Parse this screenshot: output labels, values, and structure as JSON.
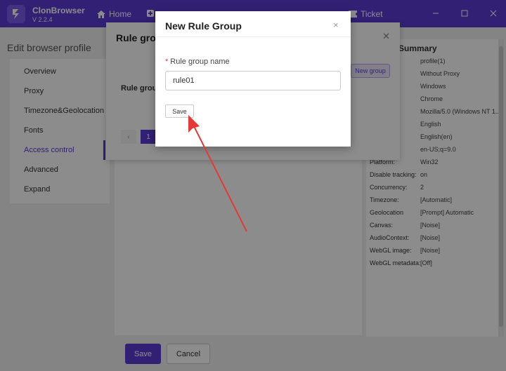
{
  "titlebar": {
    "app_name": "ClonBrowser",
    "version": "V 2.2.4",
    "home_label": "Home",
    "ticket_label": "Ticket"
  },
  "page": {
    "title": "Edit browser profile"
  },
  "sidebar": {
    "items": [
      {
        "label": "Overview"
      },
      {
        "label": "Proxy"
      },
      {
        "label": "Timezone&Geolocation"
      },
      {
        "label": "Fonts"
      },
      {
        "label": "Access control"
      },
      {
        "label": "Advanced"
      },
      {
        "label": "Expand"
      }
    ]
  },
  "rule_group_dialog": {
    "title": "Rule group",
    "new_group_label": "New group",
    "column_header": "Rule group",
    "prev_label": "‹",
    "page_number": "1"
  },
  "summary": {
    "title": "Summary",
    "rows": [
      {
        "key": "",
        "value": "profile(1)"
      },
      {
        "key": "",
        "value": "Without Proxy"
      },
      {
        "key": "",
        "value": "Windows"
      },
      {
        "key": "",
        "value": "Chrome"
      },
      {
        "key": "",
        "value": "Mozilla/5.0 (Windows NT 1..."
      },
      {
        "key": "",
        "value": "English"
      },
      {
        "key": "",
        "value": "English(en)"
      },
      {
        "key": "",
        "value": "en-US;q=9.0"
      },
      {
        "key": "Platform:",
        "value": "Win32"
      },
      {
        "key": "Disable tracking:",
        "value": "on"
      },
      {
        "key": "Concurrency:",
        "value": "2"
      },
      {
        "key": "Timezone:",
        "value": "[Automatic]"
      },
      {
        "key": "Geolocation",
        "value": "[Prompt] Automatic"
      },
      {
        "key": "Canvas:",
        "value": "[Noise]"
      },
      {
        "key": "AudioContext:",
        "value": "[Noise]"
      },
      {
        "key": "WebGL image:",
        "value": "[Noise]"
      },
      {
        "key": "WebGL metadata:",
        "value": "[Off]"
      }
    ]
  },
  "footer": {
    "save_label": "Save",
    "cancel_label": "Cancel"
  },
  "modal": {
    "title": "New Rule Group",
    "close_label": "×",
    "required_mark": "*",
    "field_label": "Rule group name",
    "field_value": "rule01",
    "save_label": "Save"
  },
  "colors": {
    "accent": "#5b3bd6",
    "annotation_arrow": "#e53935"
  }
}
